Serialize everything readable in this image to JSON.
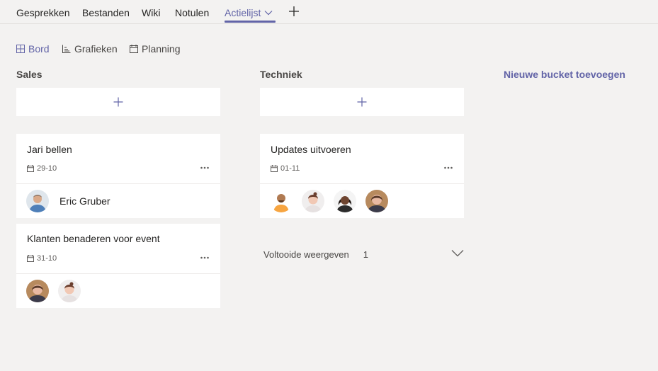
{
  "tabs": {
    "items": [
      "Gesprekken",
      "Bestanden",
      "Wiki",
      "Notulen",
      "Actielijst"
    ]
  },
  "views": {
    "board": "Bord",
    "charts": "Grafieken",
    "schedule": "Planning"
  },
  "buckets": [
    {
      "title": "Sales",
      "cards": [
        {
          "title": "Jari bellen",
          "due": "29-10",
          "assignee": "Eric Gruber"
        },
        {
          "title": "Klanten benaderen voor event",
          "due": "31-10"
        }
      ]
    },
    {
      "title": "Techniek",
      "cards": [
        {
          "title": "Updates uitvoeren",
          "due": "01-11"
        }
      ],
      "completed": {
        "label": "Voltooide weergeven",
        "count": "1"
      }
    }
  ],
  "new_bucket_label": "Nieuwe bucket toevoegen",
  "colors": {
    "accent": "#6264a7",
    "background": "#f3f2f1",
    "card": "#ffffff"
  },
  "icons": [
    "chevron-down-icon",
    "plus-icon",
    "board-icon",
    "chart-icon",
    "calendar-icon",
    "more-icon"
  ]
}
